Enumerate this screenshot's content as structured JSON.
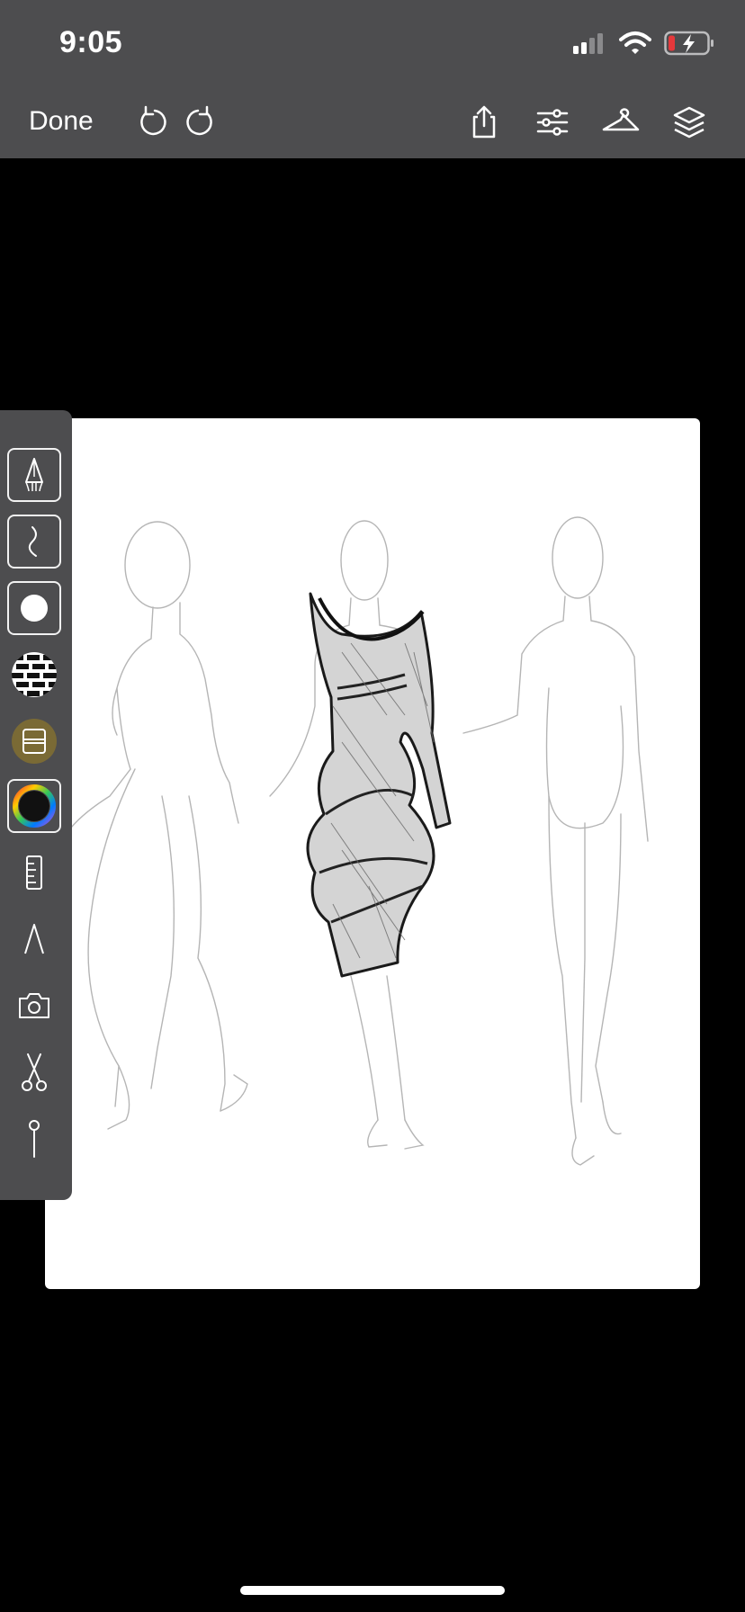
{
  "status_bar": {
    "time": "9:05",
    "icons": [
      "cellular-signal-icon",
      "wifi-icon",
      "battery-charging-icon"
    ],
    "battery_low_color": "#e5383b"
  },
  "toolbar": {
    "done_label": "Done",
    "icons": [
      "undo-icon",
      "redo-icon",
      "share-icon",
      "adjust-sliders-icon",
      "hanger-icon",
      "layers-icon"
    ]
  },
  "tools": [
    {
      "name": "pen-tool",
      "icon": "pen-nib-icon",
      "selected": true
    },
    {
      "name": "pencil-stroke-tool",
      "icon": "stroke-icon",
      "selected": true
    },
    {
      "name": "brush-size-tool",
      "icon": "filled-circle-icon",
      "selected": true
    },
    {
      "name": "pattern-tool",
      "icon": "pattern-swatch-icon",
      "selected": false
    },
    {
      "name": "fabric-tool",
      "icon": "fabric-icon",
      "selected": false,
      "color": "#7a6a35"
    },
    {
      "name": "color-picker-tool",
      "icon": "color-wheel-icon",
      "selected": true
    },
    {
      "name": "ruler-tool",
      "icon": "ruler-icon",
      "selected": false
    },
    {
      "name": "shape-tool",
      "icon": "triangle-shape-icon",
      "selected": false
    },
    {
      "name": "camera-tool",
      "icon": "camera-icon",
      "selected": false
    },
    {
      "name": "cut-tool",
      "icon": "scissors-icon",
      "selected": false
    },
    {
      "name": "pin-tool",
      "icon": "pin-icon",
      "selected": false
    }
  ],
  "colors": {
    "toolbar_bg": "#4d4d4f",
    "canvas_bg": "#000000",
    "paper_bg": "#ffffff"
  }
}
